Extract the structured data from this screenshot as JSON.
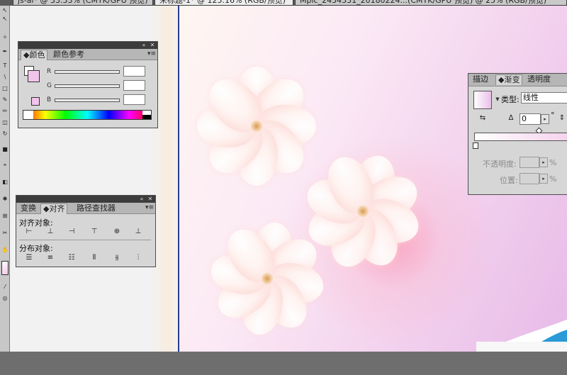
{
  "doc_tabs": [
    "js-ai* @ 33.33% (CMYK/GPU 预览)",
    "未标题-1* @ 125.16% (RGB/预览)",
    "Mpic_2434331_20180224...(CMYK/GPU 预览) @ 25% (RGB/预览)"
  ],
  "color_panel": {
    "tabs": [
      "颜色",
      "颜色参考"
    ],
    "channels": [
      "R",
      "G",
      "B"
    ],
    "values": [
      "",
      "",
      ""
    ],
    "fill_color": "#f2c4ea",
    "stroke_color": "#ffffff"
  },
  "align_panel": {
    "tabs": [
      "变换",
      "对齐",
      "路径查找器"
    ],
    "align_objects_label": "对齐对象:",
    "distribute_objects_label": "分布对象:"
  },
  "gradient_panel": {
    "tabs": [
      "描边",
      "渐变",
      "透明度"
    ],
    "type_label": "类型:",
    "type_value": "线性",
    "angle_value": "0",
    "degree_symbol": "°",
    "opacity_label": "不透明度:",
    "opacity_unit": "%",
    "location_label": "位置:",
    "location_unit": "%",
    "start_color": "#ffffff",
    "end_color": "#f3cdea"
  },
  "icons": {
    "collapse": "«",
    "close": "✕",
    "panel_menu": "▾≡",
    "dropdown": "▼",
    "stepper": "▸"
  }
}
